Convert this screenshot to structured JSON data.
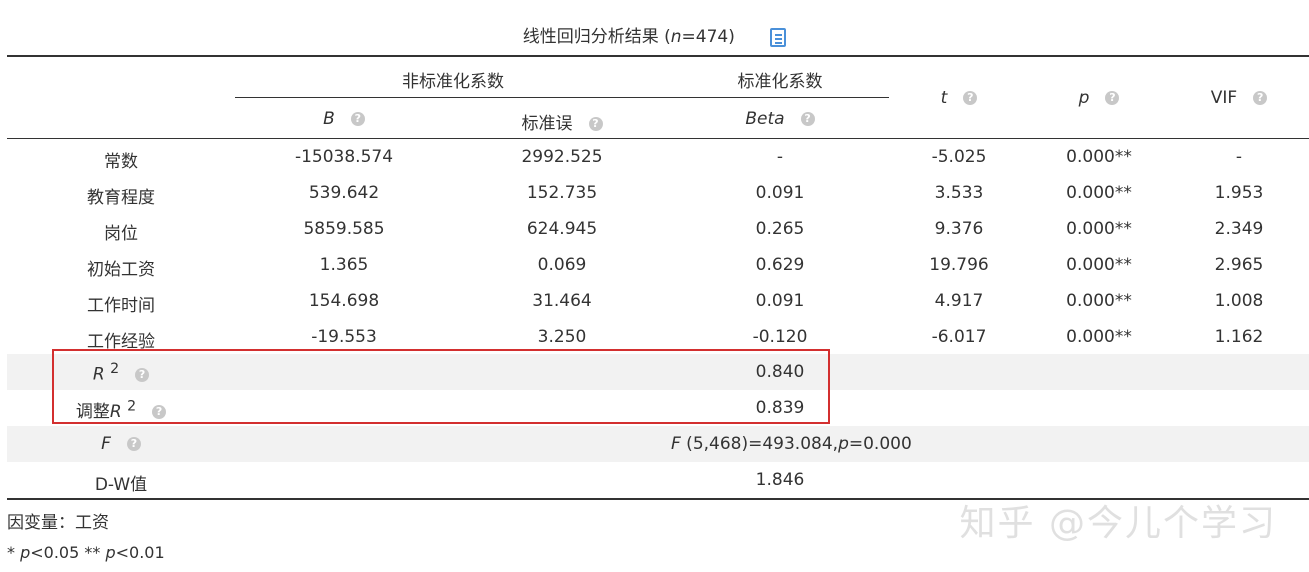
{
  "title": {
    "prefix": "线性回归分析结果 (",
    "n_label": "n",
    "n_value": "=474)"
  },
  "header": {
    "unstd": "非标准化系数",
    "std": "标准化系数",
    "b": "B",
    "se": "标准误",
    "beta": "Beta",
    "t": "t",
    "p": "p",
    "vif": "VIF"
  },
  "rows": [
    {
      "name": "常数",
      "b": "-15038.574",
      "se": "2992.525",
      "beta": "-",
      "t": "-5.025",
      "p": "0.000**",
      "vif": "-"
    },
    {
      "name": "教育程度",
      "b": "539.642",
      "se": "152.735",
      "beta": "0.091",
      "t": "3.533",
      "p": "0.000**",
      "vif": "1.953"
    },
    {
      "name": "岗位",
      "b": "5859.585",
      "se": "624.945",
      "beta": "0.265",
      "t": "9.376",
      "p": "0.000**",
      "vif": "2.349"
    },
    {
      "name": "初始工资",
      "b": "1.365",
      "se": "0.069",
      "beta": "0.629",
      "t": "19.796",
      "p": "0.000**",
      "vif": "2.965"
    },
    {
      "name": "工作时间",
      "b": "154.698",
      "se": "31.464",
      "beta": "0.091",
      "t": "4.917",
      "p": "0.000**",
      "vif": "1.008"
    },
    {
      "name": "工作经验",
      "b": "-19.553",
      "se": "3.250",
      "beta": "-0.120",
      "t": "-6.017",
      "p": "0.000**",
      "vif": "1.162"
    }
  ],
  "summary": {
    "r2_label": "R",
    "r2_sup": "2",
    "r2_value": "0.840",
    "adj_prefix": "调整",
    "adj_label": "R",
    "adj_sup": "2",
    "adj_value": "0.839",
    "f_label": "F",
    "f_value_prefix": "F",
    "f_value_mid": " (5,468)=493.084,",
    "f_value_p": "p",
    "f_value_end": "=0.000",
    "dw_label": "D-W值",
    "dw_value": "1.846"
  },
  "footer": {
    "dependent": "因变量：工资",
    "note_star": "* ",
    "note_p1": "p",
    "note_mid": "<0.05 ** ",
    "note_p2": "p",
    "note_end": "<0.01"
  },
  "watermark": "知乎 @今儿个学习",
  "colors": {
    "highlight_box": "#d32f2f",
    "copy_icon": "#4a90d9",
    "shade_row": "#f2f2f2"
  }
}
